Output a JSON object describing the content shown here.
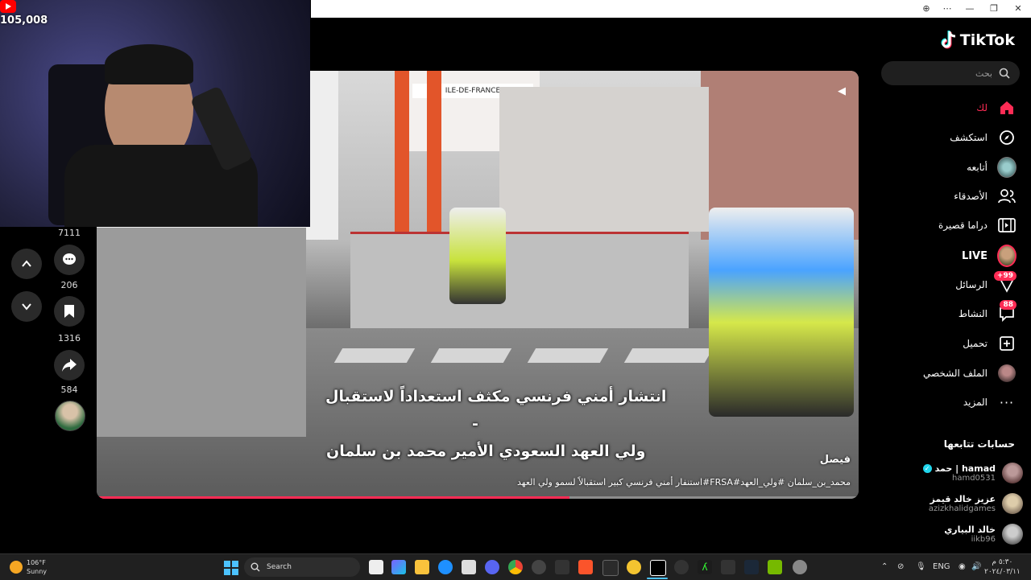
{
  "stream": {
    "youtube_viewers": "105,008"
  },
  "window": {
    "titlebar_buttons": [
      "⊕",
      "⋯",
      "—",
      "❐",
      "✕"
    ]
  },
  "tiktok": {
    "logo_text": "TikTok",
    "search_placeholder": "بحث",
    "nav": [
      {
        "label": "لك",
        "icon": "home-icon",
        "active": true
      },
      {
        "label": "استكشف",
        "icon": "compass-icon"
      },
      {
        "label": "أتابعه",
        "icon": "following-avatar-icon"
      },
      {
        "label": "الأصدقاء",
        "icon": "friends-icon"
      },
      {
        "label": "دراما قصيرة",
        "icon": "film-icon"
      },
      {
        "label": "LIVE",
        "icon": "live-avatar-icon"
      },
      {
        "label": "الرسائل",
        "icon": "messages-icon",
        "badge": "+99"
      },
      {
        "label": "النشاط",
        "icon": "activity-icon",
        "badge": "88"
      },
      {
        "label": "تحميل",
        "icon": "upload-icon"
      },
      {
        "label": "الملف الشخصي",
        "icon": "profile-avatar-icon"
      },
      {
        "label": "المزيد",
        "icon": "more-icon"
      }
    ],
    "following_title": "حسابات تتابعها",
    "following": [
      {
        "name": "حمد | hamad",
        "handle": "hamd0531",
        "verified": true
      },
      {
        "name": "عزيز خالد قيمز",
        "handle": "azizkhalidgames"
      },
      {
        "name": "خالد البياري",
        "handle": "iikb96"
      }
    ],
    "actions": {
      "likes_count": "7111",
      "comments_count": "206",
      "saves_count": "1316",
      "shares_count": "584"
    },
    "video": {
      "subtitle_line1": "انتشار أمني فرنسي مكثف استعداداً لاستقبال",
      "subtitle_dash": "-",
      "subtitle_line2": "ولي العهد السعودي الأمير محمد بن سلمان",
      "author": "فيصل",
      "caption": "استنفار أمني فرنسي كبير استقبالاً لسمو ولي العهد#FRSA#محمد_بن_سلمان #ولي_العهد",
      "sign_text": "ILE-DE-FRANCE",
      "progress": 0.62
    }
  },
  "taskbar": {
    "weather_temp": "106°F",
    "weather_desc": "Sunny",
    "search_label": "Search",
    "lang": "ENG",
    "clock_time": "٥:٣٠ م",
    "clock_date": "٢٠٢٤/٠٣/١١"
  },
  "colors": {
    "accent": "#fe2c55",
    "bg": "#000000",
    "taskbar": "#202020"
  }
}
